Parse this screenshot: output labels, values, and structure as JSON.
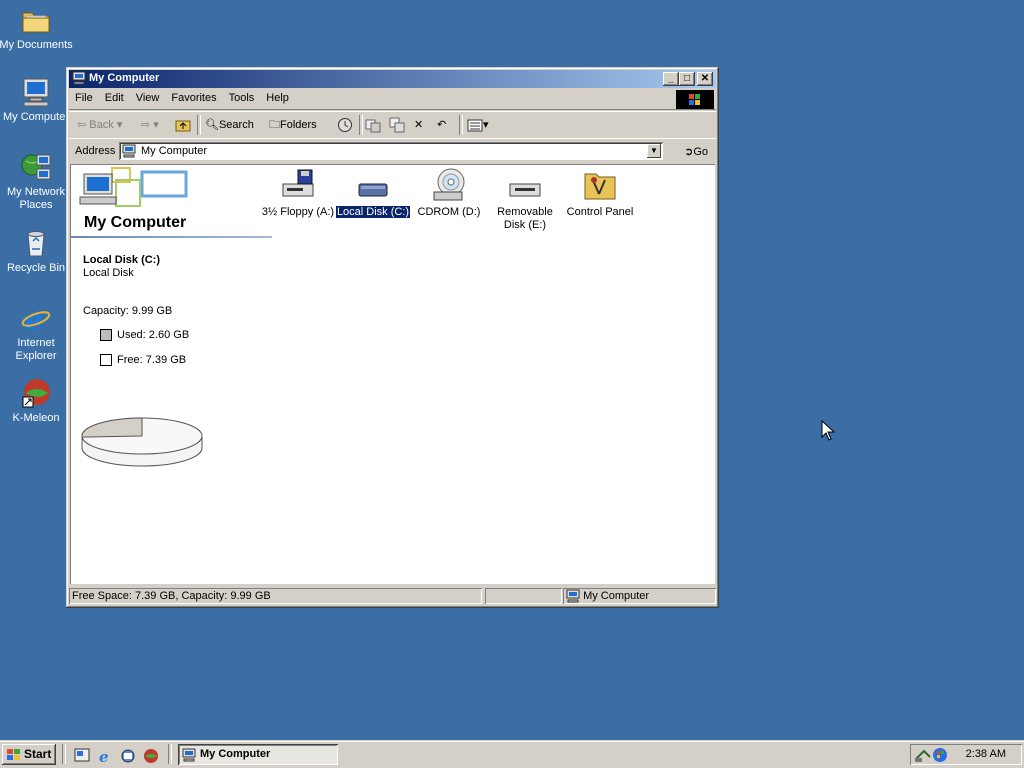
{
  "desktop": {
    "icons": [
      {
        "label": "My Documents",
        "icon": "folder-icon"
      },
      {
        "label": "My Computer",
        "icon": "computer-icon"
      },
      {
        "label": "My Network Places",
        "icon": "network-icon"
      },
      {
        "label": "Recycle Bin",
        "icon": "recycle-bin-icon"
      },
      {
        "label": "Internet Explorer",
        "icon": "ie-icon"
      },
      {
        "label": "K-Meleon",
        "icon": "k-meleon-icon"
      }
    ]
  },
  "window": {
    "title": "My Computer",
    "menu": [
      "File",
      "Edit",
      "View",
      "Favorites",
      "Tools",
      "Help"
    ],
    "toolbar": {
      "back": "Back",
      "search": "Search",
      "folders": "Folders"
    },
    "address": {
      "label": "Address",
      "value": "My Computer",
      "go": "Go"
    },
    "left_pane": {
      "title": "My Computer",
      "drive_name": "Local Disk (C:)",
      "drive_type": "Local Disk",
      "capacity": "Capacity: 9.99 GB",
      "used": "Used: 2.60 GB",
      "free": "Free: 7.39 GB"
    },
    "items": [
      {
        "label": "3½ Floppy (A:)",
        "icon": "floppy-drive-icon",
        "selected": false
      },
      {
        "label": "Local Disk (C:)",
        "icon": "hard-disk-icon",
        "selected": true
      },
      {
        "label": "CDROM (D:)",
        "icon": "cdrom-icon",
        "selected": false
      },
      {
        "label": "Removable Disk (E:)",
        "icon": "removable-disk-icon",
        "selected": false
      },
      {
        "label": "Control Panel",
        "icon": "control-panel-icon",
        "selected": false
      }
    ],
    "status": {
      "left": "Free Space: 7.39 GB, Capacity: 9.99 GB",
      "zone": "My Computer"
    }
  },
  "disk_usage": {
    "used_gb": 2.6,
    "free_gb": 7.39,
    "capacity_gb": 9.99
  },
  "taskbar": {
    "start": "Start",
    "task": "My Computer",
    "clock": "2:38 AM"
  },
  "colors": {
    "desktop": "#3a6ea5",
    "title_active": "#0a246a",
    "face": "#d4d0c8",
    "selection": "#0a246a"
  }
}
